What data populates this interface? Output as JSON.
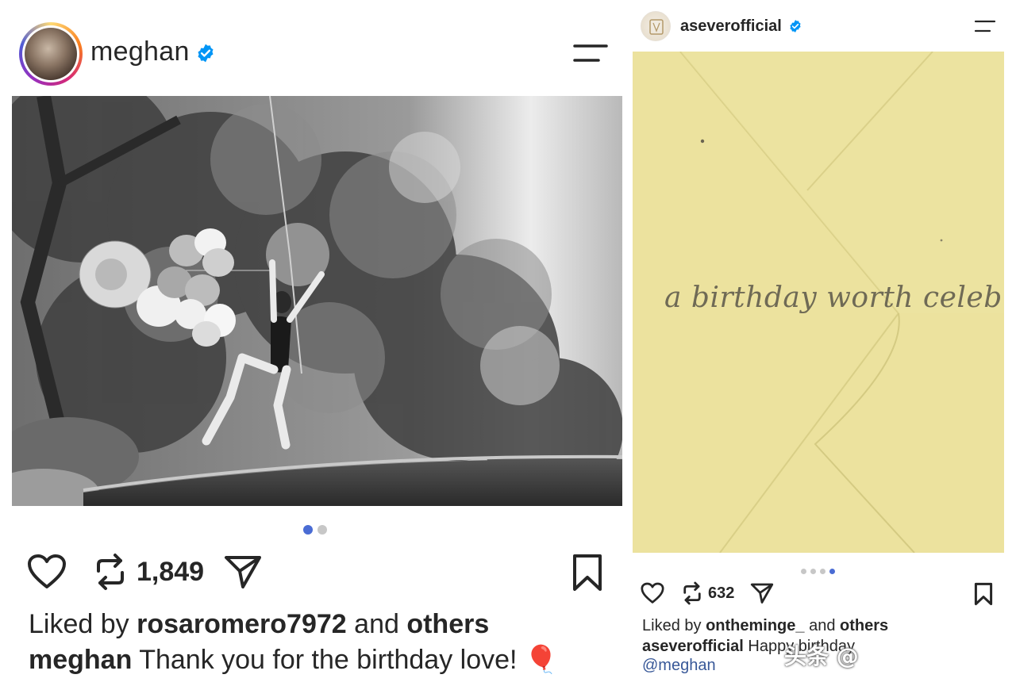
{
  "left_post": {
    "username": "meghan",
    "verified_icon": "verified-badge-icon",
    "menu_icon": "menu-icon",
    "photo_description_icon": "photo",
    "carousel": {
      "total": 2,
      "active": 1
    },
    "actions": {
      "like_icon": "heart-icon",
      "repost_icon": "repost-icon",
      "repost_count": "1,849",
      "share_icon": "send-icon",
      "save_icon": "bookmark-icon"
    },
    "liked_by": {
      "prefix": "Liked by",
      "user": "rosaromero7972",
      "middle": "and",
      "others": "others"
    },
    "caption": {
      "user": "meghan",
      "text": "Thank you for the birthday love!",
      "emoji": "🎈"
    }
  },
  "right_post": {
    "username": "aseverofficial",
    "verified_icon": "verified-badge-icon",
    "menu_icon": "menu-icon",
    "card_text": "a birthday worth celebrating",
    "carousel": {
      "total": 4,
      "active": 4
    },
    "actions": {
      "like_icon": "heart-icon",
      "repost_icon": "repost-icon",
      "repost_count": "632",
      "share_icon": "send-icon",
      "save_icon": "bookmark-icon"
    },
    "liked_by": {
      "prefix": "Liked by",
      "user": "ontheminge_",
      "middle": "and",
      "others": "others"
    },
    "caption": {
      "user": "aseverofficial",
      "text": "Happy birthday"
    },
    "mention": "@meghan"
  },
  "watermark": {
    "text": "头条 @"
  },
  "colors": {
    "accent_blue": "#0095f6",
    "dot_active": "#4a6cd4",
    "dot_inactive": "#c7c7c7",
    "envelope": "#ece29e",
    "mention": "#385898"
  }
}
